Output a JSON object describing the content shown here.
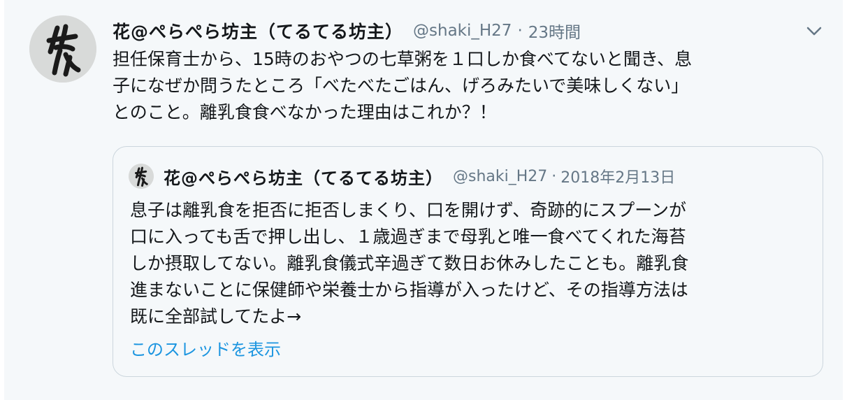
{
  "tweet": {
    "display_name": "花@ぺらぺら坊主（てるてる坊主）",
    "handle": "@shaki_H27",
    "separator": "·",
    "time": "23時間",
    "text": "担任保育士から、15時のおやつの七草粥を１口しか食べてないと聞き、息\n子になぜか問うたところ「べたべたごはん、げろみたいで美味しくない」\nとのこと。離乳食食べなかった理由はこれか？！",
    "avatar_icon": "calligraphy-avatar-icon",
    "menu_icon": "chevron-down-icon"
  },
  "quoted": {
    "display_name": "花@ぺらぺら坊主（てるてる坊主）",
    "handle": "@shaki_H27",
    "separator": "·",
    "date": "2018年2月13日",
    "text": "息子は離乳食を拒否に拒否しまくり、口を開けず、奇跡的にスプーンが\n口に入っても舌で押し出し、１歳過ぎまで母乳と唯一食べてくれた海苔\nしか摂取してない。離乳食儀式辛過ぎて数日お休みしたことも。離乳食\n進まないことに保健師や栄養士から指導が入ったけど、その指導方法は\n既に全部試してたよ→",
    "show_thread_label": "このスレッドを表示"
  },
  "colors": {
    "background": "#f5f8fa",
    "text": "#14171a",
    "secondary": "#657786",
    "link": "#1b95e0",
    "border": "#ccd6dd"
  }
}
